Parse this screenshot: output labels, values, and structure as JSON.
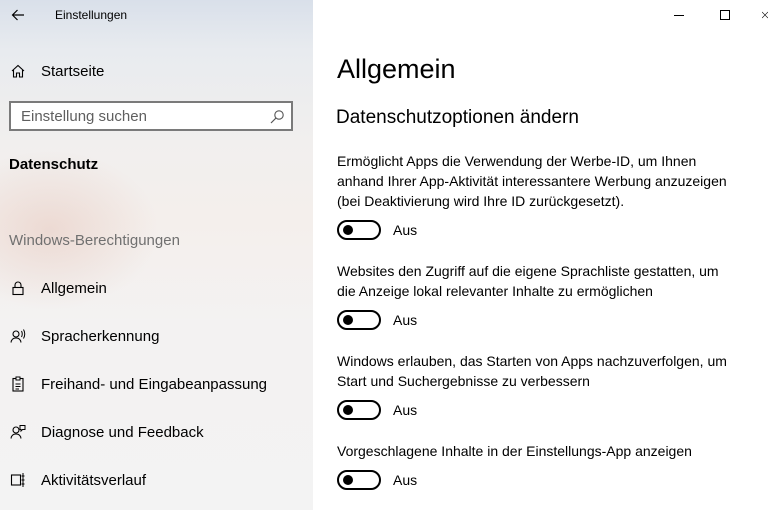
{
  "window": {
    "title": "Einstellungen"
  },
  "sidebar": {
    "home_label": "Startseite",
    "search": {
      "placeholder": "Einstellung suchen"
    },
    "section_title": "Datenschutz",
    "group_title": "Windows-Berechtigungen",
    "items": [
      {
        "label": "Allgemein",
        "icon": "lock-icon"
      },
      {
        "label": "Spracherkennung",
        "icon": "speech-icon"
      },
      {
        "label": "Freihand- und Eingabeanpassung",
        "icon": "clipboard-pen-icon"
      },
      {
        "label": "Diagnose und Feedback",
        "icon": "feedback-icon"
      },
      {
        "label": "Aktivitätsverlauf",
        "icon": "timeline-icon"
      }
    ]
  },
  "main": {
    "title": "Allgemein",
    "subtitle": "Datenschutzoptionen ändern",
    "options": [
      {
        "lines": [
          "Ermöglicht Apps die Verwendung der Werbe-ID, um Ihnen",
          "anhand Ihrer App-Aktivität interessantere Werbung anzuzeigen",
          "(bei Deaktivierung wird Ihre ID zurückgesetzt)."
        ],
        "state": "Aus"
      },
      {
        "lines": [
          "Websites den Zugriff auf die eigene Sprachliste gestatten, um",
          "die Anzeige lokal relevanter Inhalte zu ermöglichen"
        ],
        "state": "Aus"
      },
      {
        "lines": [
          "Windows erlauben, das Starten von Apps nachzuverfolgen, um",
          "Start und Suchergebnisse zu verbessern"
        ],
        "state": "Aus"
      },
      {
        "lines": [
          "Vorgeschlagene Inhalte in der Einstellungs-App anzeigen"
        ],
        "state": "Aus"
      }
    ]
  }
}
